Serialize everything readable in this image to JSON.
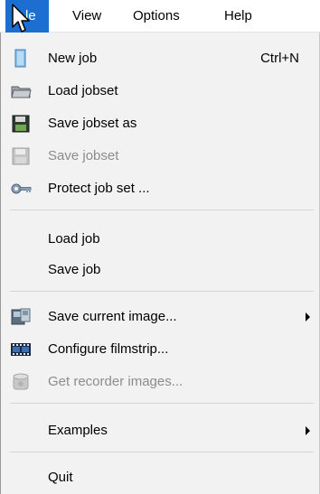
{
  "menubar": {
    "file": "File",
    "file_visible": "le",
    "view": "View",
    "options": "Options",
    "help": "Help"
  },
  "menu": {
    "new_job": {
      "label": "New job",
      "shortcut": "Ctrl+N",
      "icon": "new-document-icon"
    },
    "load_jobset": {
      "label": "Load jobset",
      "icon": "folder-icon"
    },
    "save_jobset_as": {
      "label": "Save jobset as",
      "icon": "floppy-disk-icon"
    },
    "save_jobset": {
      "label": "Save jobset",
      "icon": "floppy-disk-icon",
      "disabled": true
    },
    "protect_job_set": {
      "label": "Protect job set ...",
      "icon": "key-icon"
    },
    "load_job": {
      "label": "Load job"
    },
    "save_job": {
      "label": "Save job"
    },
    "save_current_image": {
      "label": "Save current image...",
      "icon": "save-image-icon",
      "submenu": true
    },
    "configure_filmstrip": {
      "label": "Configure filmstrip...",
      "icon": "filmstrip-icon"
    },
    "get_recorder_images": {
      "label": "Get recorder images...",
      "icon": "recorder-icon",
      "disabled": true
    },
    "examples": {
      "label": "Examples",
      "submenu": true
    },
    "quit": {
      "label": "Quit"
    }
  },
  "colors": {
    "accent": "#1c6fd1",
    "menu_bg": "#f2f2f2",
    "disabled_text": "#8c8c8c"
  }
}
